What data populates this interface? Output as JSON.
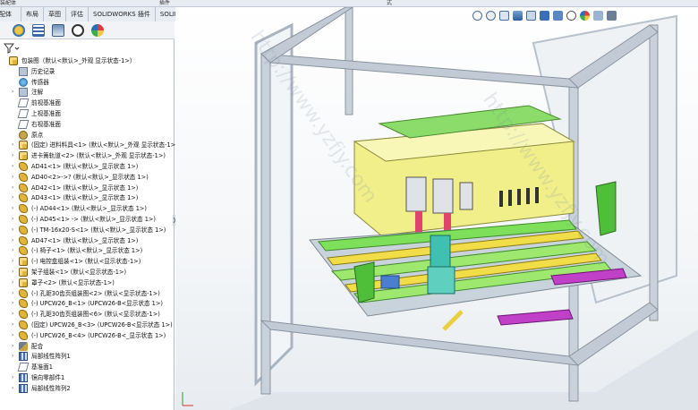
{
  "topbar": {
    "left_label": "装配体",
    "mid_label": "插件",
    "right_label": "式"
  },
  "tabs": [
    "装配体",
    "布局",
    "草图",
    "评估",
    "SOLIDWORKS 插件",
    "SOLIDWORKS MBD"
  ],
  "tree": [
    {
      "label": "包装图（默认<默认>_外观 显示状态-1>）",
      "icon": "assembly-icon",
      "indent": 0,
      "expander": false
    },
    {
      "label": "历史记录",
      "icon": "history-icon",
      "indent": 1,
      "expander": false
    },
    {
      "label": "传感器",
      "icon": "sensor-icon",
      "indent": 1,
      "expander": false
    },
    {
      "label": "注解",
      "icon": "annotation-icon",
      "indent": 1,
      "expander": true
    },
    {
      "label": "前视基准面",
      "icon": "plane-icon",
      "indent": 1,
      "expander": false
    },
    {
      "label": "上视基准面",
      "icon": "plane-icon",
      "indent": 1,
      "expander": false
    },
    {
      "label": "右视基准面",
      "icon": "plane-icon",
      "indent": 1,
      "expander": false
    },
    {
      "label": "原点",
      "icon": "origin-icon",
      "indent": 1,
      "expander": false
    },
    {
      "label": "(固定) 进料料具<1> (默认<默认>_外观 显示状态-1>)",
      "icon": "assembly-icon",
      "indent": 1,
      "expander": true
    },
    {
      "label": "进卡簧轨道<2> (默认<默认>_外观 显示状态-1>)",
      "icon": "assembly-icon",
      "indent": 1,
      "expander": true
    },
    {
      "label": "AD41<1> (默认<默认>_显示状态 1>)",
      "icon": "part-icon",
      "indent": 1,
      "expander": true
    },
    {
      "label": "AD40<2>->? (默认<默认>_显示状态 1>)",
      "icon": "part-icon",
      "indent": 1,
      "expander": true
    },
    {
      "label": "AD42<1> (默认<默认>_显示状态 1>)",
      "icon": "part-icon",
      "indent": 1,
      "expander": true
    },
    {
      "label": "AD43<1> (默认<默认>_显示状态 1>)",
      "icon": "part-icon",
      "indent": 1,
      "expander": true
    },
    {
      "label": "(-) AD44<1> (默认<默认>_显示状态 1>)",
      "icon": "part-icon",
      "indent": 1,
      "expander": true
    },
    {
      "label": "(-) AD45<1> -> (默认<默认>_显示状态 1>)",
      "icon": "part-icon",
      "indent": 1,
      "expander": true
    },
    {
      "label": "(-) TM-16x20-S<1> (默认<默认>_显示状态 1>)",
      "icon": "part-icon",
      "indent": 1,
      "expander": true
    },
    {
      "label": "AD47<1> (默认<默认>_显示状态 1>)",
      "icon": "part-icon",
      "indent": 1,
      "expander": true
    },
    {
      "label": "(-) 椅子<1> (默认<默认>_显示状态 1>)",
      "icon": "part-icon",
      "indent": 1,
      "expander": true
    },
    {
      "label": "(-) 电控盒组装<1> (默认<显示状态-1>)",
      "icon": "assembly-icon",
      "indent": 1,
      "expander": true
    },
    {
      "label": "架子组装<1> (默认<显示状态-1>)",
      "icon": "assembly-icon",
      "indent": 1,
      "expander": true
    },
    {
      "label": "罩子<2> (默认<显示状态-1>)",
      "icon": "assembly-icon",
      "indent": 1,
      "expander": true
    },
    {
      "label": "(-) 孔距30齿页组装图<2> (默认<显示状态-1>)",
      "icon": "part-icon",
      "indent": 1,
      "expander": true
    },
    {
      "label": "(-) UPCW26_B<1> (UPCW26-B<显示状态 1>)",
      "icon": "part-icon",
      "indent": 1,
      "expander": true
    },
    {
      "label": "(-) 孔距30齿页组装图<6> (默认<显示状态-1>)",
      "icon": "part-icon",
      "indent": 1,
      "expander": true
    },
    {
      "label": "(固定) UPCW26_B<3> (UPCW26-B<显示状态 1>)",
      "icon": "part-icon",
      "indent": 1,
      "expander": true
    },
    {
      "label": "(-) UPCW26_B<4> (UPCW26-B<_显示状态 1>)",
      "icon": "part-icon",
      "indent": 1,
      "expander": true
    },
    {
      "label": "配合",
      "icon": "mate-icon",
      "indent": 1,
      "expander": true
    },
    {
      "label": "局部线性阵列1",
      "icon": "pattern-icon",
      "indent": 1,
      "expander": true
    },
    {
      "label": "基准面1",
      "icon": "plane-icon",
      "indent": 1,
      "expander": false
    },
    {
      "label": "镜向零部件1",
      "icon": "mirror-icon",
      "indent": 1,
      "expander": true
    },
    {
      "label": "局部线性阵列2",
      "icon": "pattern-icon",
      "indent": 1,
      "expander": true
    }
  ],
  "watermark": {
    "text": "http://www.yzfjy.com"
  },
  "colors": {
    "accent": "#2d5fa6",
    "frame": "#b8c2cc",
    "cabinet": "#f0ef8a",
    "green": "#7ee05a",
    "magenta": "#c040c8"
  }
}
